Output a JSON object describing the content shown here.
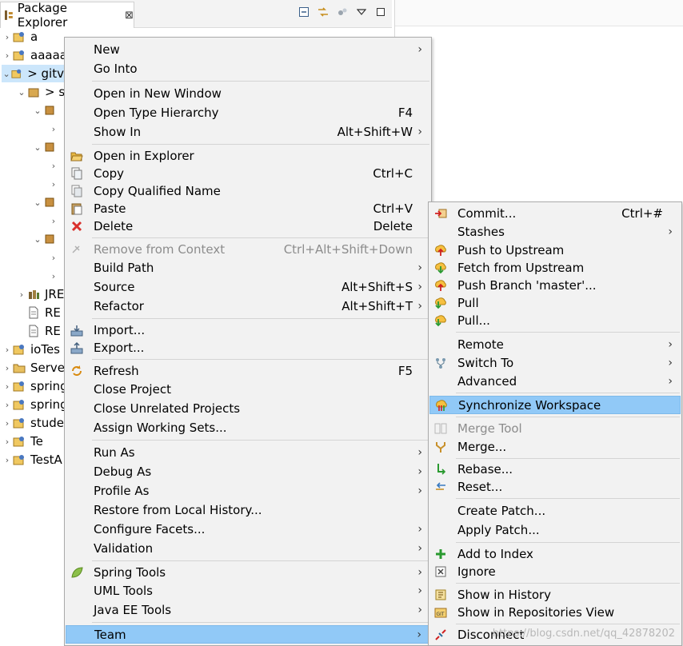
{
  "view": {
    "title": "Package Explorer",
    "close": "⊠"
  },
  "tree": [
    {
      "label": "a",
      "chevron": "›"
    },
    {
      "label": "aaaaa",
      "chevron": "›"
    },
    {
      "label": "> gitv",
      "chevron": "⌄"
    },
    {
      "label": "> s",
      "chevron": "⌄"
    },
    {
      "label": "",
      "chevron": "⌄"
    },
    {
      "label": "",
      "chevron": "›"
    },
    {
      "label": "",
      "chevron": "⌄"
    },
    {
      "label": "",
      "chevron": "›"
    },
    {
      "label": "",
      "chevron": "›"
    },
    {
      "label": "",
      "chevron": "⌄"
    },
    {
      "label": "",
      "chevron": "›"
    },
    {
      "label": "",
      "chevron": "⌄"
    },
    {
      "label": "",
      "chevron": "›"
    },
    {
      "label": "",
      "chevron": "›"
    },
    {
      "label": "JRE",
      "chevron": "›"
    },
    {
      "label": "RE",
      "chevron": ""
    },
    {
      "label": "RE",
      "chevron": ""
    },
    {
      "label": "ioTes",
      "chevron": "›"
    },
    {
      "label": "Serve",
      "chevron": "›"
    },
    {
      "label": "spring",
      "chevron": "›"
    },
    {
      "label": "spring",
      "chevron": "›"
    },
    {
      "label": "stude",
      "chevron": "›"
    },
    {
      "label": "Te",
      "chevron": "›"
    },
    {
      "label": "TestA",
      "chevron": "›"
    }
  ],
  "context_menu": {
    "items": [
      {
        "label": "New",
        "shortcut": "",
        "arrow": "›"
      },
      {
        "label": "Go Into",
        "shortcut": "",
        "arrow": ""
      },
      {
        "label": "Open in New Window",
        "shortcut": "",
        "arrow": ""
      },
      {
        "label": "Open Type Hierarchy",
        "shortcut": "F4",
        "arrow": ""
      },
      {
        "label": "Show In",
        "shortcut": "Alt+Shift+W",
        "arrow": "›"
      },
      {
        "label": "Open in Explorer",
        "shortcut": "",
        "arrow": ""
      },
      {
        "label": "Copy",
        "shortcut": "Ctrl+C",
        "arrow": ""
      },
      {
        "label": "Copy Qualified Name",
        "shortcut": "",
        "arrow": ""
      },
      {
        "label": "Paste",
        "shortcut": "Ctrl+V",
        "arrow": ""
      },
      {
        "label": "Delete",
        "shortcut": "Delete",
        "arrow": ""
      },
      {
        "label": "Remove from Context",
        "shortcut": "Ctrl+Alt+Shift+Down",
        "arrow": ""
      },
      {
        "label": "Build Path",
        "shortcut": "",
        "arrow": "›"
      },
      {
        "label": "Source",
        "shortcut": "Alt+Shift+S",
        "arrow": "›"
      },
      {
        "label": "Refactor",
        "shortcut": "Alt+Shift+T",
        "arrow": "›"
      },
      {
        "label": "Import...",
        "shortcut": "",
        "arrow": ""
      },
      {
        "label": "Export...",
        "shortcut": "",
        "arrow": ""
      },
      {
        "label": "Refresh",
        "shortcut": "F5",
        "arrow": ""
      },
      {
        "label": "Close Project",
        "shortcut": "",
        "arrow": ""
      },
      {
        "label": "Close Unrelated Projects",
        "shortcut": "",
        "arrow": ""
      },
      {
        "label": "Assign Working Sets...",
        "shortcut": "",
        "arrow": ""
      },
      {
        "label": "Run As",
        "shortcut": "",
        "arrow": "›"
      },
      {
        "label": "Debug As",
        "shortcut": "",
        "arrow": "›"
      },
      {
        "label": "Profile As",
        "shortcut": "",
        "arrow": "›"
      },
      {
        "label": "Restore from Local History...",
        "shortcut": "",
        "arrow": ""
      },
      {
        "label": "Configure Facets...",
        "shortcut": "",
        "arrow": "›"
      },
      {
        "label": "Validation",
        "shortcut": "",
        "arrow": "›"
      },
      {
        "label": "Spring Tools",
        "shortcut": "",
        "arrow": "›"
      },
      {
        "label": "UML Tools",
        "shortcut": "",
        "arrow": "›"
      },
      {
        "label": "Java EE Tools",
        "shortcut": "",
        "arrow": "›"
      },
      {
        "label": "Team",
        "shortcut": "",
        "arrow": "›"
      }
    ]
  },
  "team_menu": {
    "items": [
      {
        "label": "Commit...",
        "shortcut": "Ctrl+#",
        "arrow": ""
      },
      {
        "label": "Stashes",
        "shortcut": "",
        "arrow": "›"
      },
      {
        "label": "Push to Upstream",
        "shortcut": "",
        "arrow": ""
      },
      {
        "label": "Fetch from Upstream",
        "shortcut": "",
        "arrow": ""
      },
      {
        "label": "Push Branch 'master'...",
        "shortcut": "",
        "arrow": ""
      },
      {
        "label": "Pull",
        "shortcut": "",
        "arrow": ""
      },
      {
        "label": "Pull...",
        "shortcut": "",
        "arrow": ""
      },
      {
        "label": "Remote",
        "shortcut": "",
        "arrow": "›"
      },
      {
        "label": "Switch To",
        "shortcut": "",
        "arrow": "›"
      },
      {
        "label": "Advanced",
        "shortcut": "",
        "arrow": "›"
      },
      {
        "label": "Synchronize Workspace",
        "shortcut": "",
        "arrow": ""
      },
      {
        "label": "Merge Tool",
        "shortcut": "",
        "arrow": ""
      },
      {
        "label": "Merge...",
        "shortcut": "",
        "arrow": ""
      },
      {
        "label": "Rebase...",
        "shortcut": "",
        "arrow": ""
      },
      {
        "label": "Reset...",
        "shortcut": "",
        "arrow": ""
      },
      {
        "label": "Create Patch...",
        "shortcut": "",
        "arrow": ""
      },
      {
        "label": "Apply Patch...",
        "shortcut": "",
        "arrow": ""
      },
      {
        "label": "Add to Index",
        "shortcut": "",
        "arrow": ""
      },
      {
        "label": "Ignore",
        "shortcut": "",
        "arrow": ""
      },
      {
        "label": "Show in History",
        "shortcut": "",
        "arrow": ""
      },
      {
        "label": "Show in Repositories View",
        "shortcut": "",
        "arrow": ""
      },
      {
        "label": "Disconnect",
        "shortcut": "",
        "arrow": ""
      }
    ]
  },
  "watermark": "https://blog.csdn.net/qq_42878202",
  "colors": {
    "menu_bg": "#f2f2f2",
    "highlight": "#91c9f7",
    "disabled_text": "#8c8c8c",
    "delete_red": "#d9302c"
  }
}
